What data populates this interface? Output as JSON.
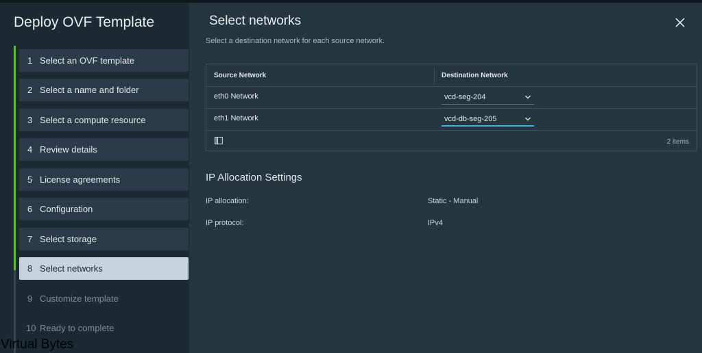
{
  "wizard": {
    "title": "Deploy OVF Template",
    "steps": [
      {
        "num": "1",
        "label": "Select an OVF template",
        "state": "done"
      },
      {
        "num": "2",
        "label": "Select a name and folder",
        "state": "done"
      },
      {
        "num": "3",
        "label": "Select a compute resource",
        "state": "done"
      },
      {
        "num": "4",
        "label": "Review details",
        "state": "done"
      },
      {
        "num": "5",
        "label": "License agreements",
        "state": "done"
      },
      {
        "num": "6",
        "label": "Configuration",
        "state": "done"
      },
      {
        "num": "7",
        "label": "Select storage",
        "state": "done"
      },
      {
        "num": "8",
        "label": "Select networks",
        "state": "active"
      },
      {
        "num": "9",
        "label": "Customize template",
        "state": "disabled"
      },
      {
        "num": "10",
        "label": "Ready to complete",
        "state": "disabled"
      }
    ]
  },
  "page": {
    "title": "Select networks",
    "subtitle": "Select a destination network for each source network.",
    "close_icon": "close-icon"
  },
  "networks_table": {
    "columns": [
      "Source Network",
      "Destination Network"
    ],
    "rows": [
      {
        "source": "eth0 Network",
        "destination": "vcd-seg-204"
      },
      {
        "source": "eth1 Network",
        "destination": "vcd-db-seg-205"
      }
    ],
    "footer_count": "2 items",
    "column_toggle_icon": "column-toggle-icon"
  },
  "ip_allocation": {
    "title": "IP Allocation Settings",
    "allocation_label": "IP allocation:",
    "allocation_value": "Static - Manual",
    "protocol_label": "IP protocol:",
    "protocol_value": "IPv4"
  },
  "watermark": "Virtual Bytes",
  "colors": {
    "accent_green": "#5fb83a",
    "focus_blue": "#49afd9",
    "sidebar_bg": "#1c2a33",
    "main_bg": "#243640"
  }
}
